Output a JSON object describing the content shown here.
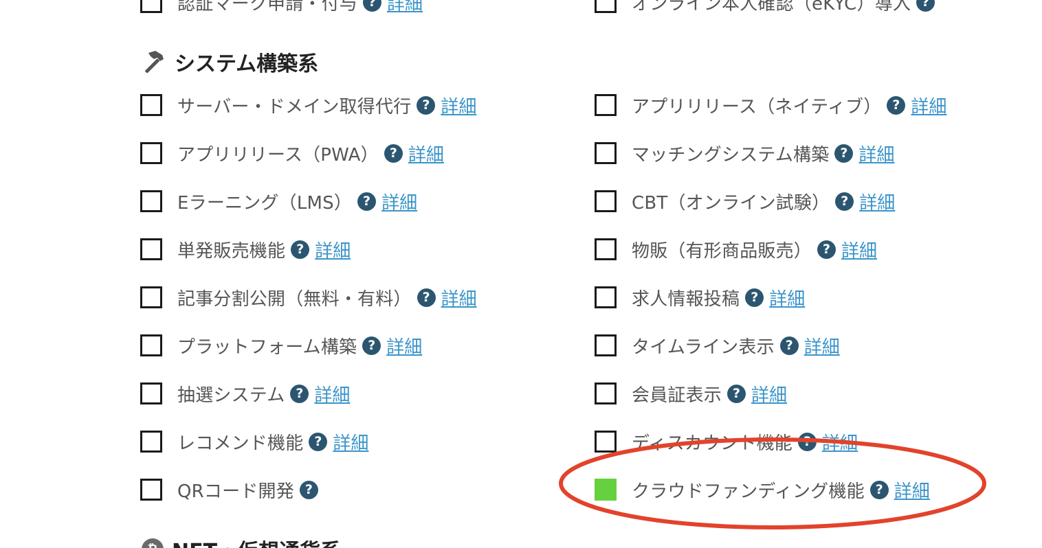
{
  "colors": {
    "help_icon": "#2c5670",
    "link": "#3a94c9",
    "checked": "#65d13e",
    "annotation": "#e2432b"
  },
  "top_partial": {
    "left_label": "認証マーク申請・付与",
    "left_link": "詳細",
    "right_label": "オンライン本人確認（eKYC）導入"
  },
  "section_system": {
    "icon": "hammer-icon",
    "title": "システム構築系"
  },
  "help_glyph": "?",
  "items_left": [
    {
      "label": "サーバー・ドメイン取得代行",
      "link": "詳細"
    },
    {
      "label": "アプリリリース（PWA）",
      "link": "詳細"
    },
    {
      "label": "Eラーニング（LMS）",
      "link": "詳細"
    },
    {
      "label": "単発販売機能",
      "link": "詳細"
    },
    {
      "label": "記事分割公開（無料・有料）",
      "link": "詳細"
    },
    {
      "label": "プラットフォーム構築",
      "link": "詳細"
    },
    {
      "label": "抽選システム",
      "link": "詳細"
    },
    {
      "label": "レコメンド機能",
      "link": "詳細"
    },
    {
      "label": "QRコード開発"
    }
  ],
  "items_right": [
    {
      "label": "アプリリリース（ネイティブ）",
      "link": "詳細"
    },
    {
      "label": "マッチングシステム構築",
      "link": "詳細"
    },
    {
      "label": "CBT（オンライン試験）",
      "link": "詳細"
    },
    {
      "label": "物販（有形商品販売）",
      "link": "詳細"
    },
    {
      "label": "求人情報投稿",
      "link": "詳細"
    },
    {
      "label": "タイムライン表示",
      "link": "詳細"
    },
    {
      "label": "会員証表示",
      "link": "詳細"
    },
    {
      "label": "ディスカウント機能",
      "link": "詳細"
    },
    {
      "label": "クラウドファンディング機能",
      "link": "詳細",
      "checked": true
    }
  ],
  "section_nft": {
    "icon": "bitcoin-icon",
    "icon_glyph": "₿",
    "title": "NFT・仮想通貨系"
  }
}
